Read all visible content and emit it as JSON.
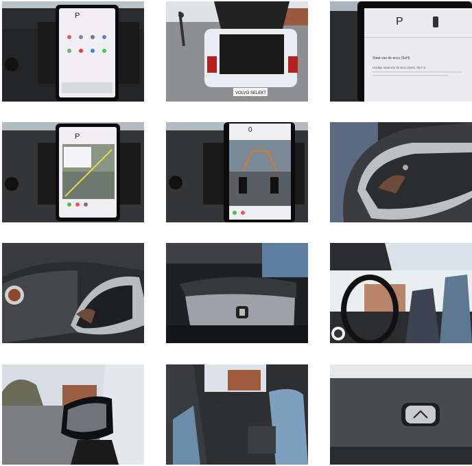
{
  "gallery": {
    "tiles": [
      {
        "name": "dashboard-touchscreen-home",
        "screen_text": "P"
      },
      {
        "name": "open-trunk-rear-view",
        "badge_text": "VOLVO SELEKT"
      },
      {
        "name": "screen-battery-status",
        "screen_text": "P",
        "title": "Staat van de accu (SoH)",
        "detail": "Huidige staat van de accu (SoH): 99,0 %"
      },
      {
        "name": "screen-navigation-map",
        "screen_text": "P"
      },
      {
        "name": "screen-parking-camera",
        "screen_text": "0"
      },
      {
        "name": "steering-wheel-left-controls"
      },
      {
        "name": "steering-wheel-right-controls"
      },
      {
        "name": "seat-adjustment-controls"
      },
      {
        "name": "panoramic-roof-interior"
      },
      {
        "name": "side-mirror-exterior"
      },
      {
        "name": "rear-seats"
      },
      {
        "name": "trunk-release-button"
      }
    ]
  }
}
